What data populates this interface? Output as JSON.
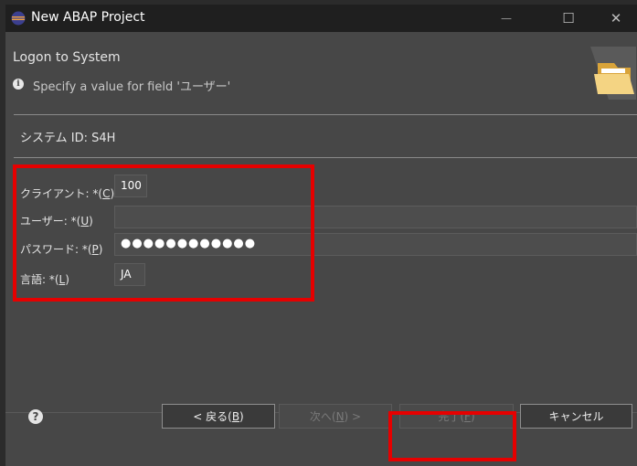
{
  "window": {
    "title": "New ABAP Project",
    "controls": {
      "minimize": "—",
      "maximize": "☐",
      "close": "✕"
    }
  },
  "header": {
    "title": "Logon to System",
    "message": "Specify a value for field 'ユーザー'",
    "info_icon": "i"
  },
  "system": {
    "label": "システム ID: S4H"
  },
  "form": {
    "client": {
      "label_prefix": "クライアント: *(",
      "mnemonic": "C",
      "label_suffix": ")",
      "value": "100"
    },
    "user": {
      "label_prefix": "ユーザー: *(",
      "mnemonic": "U",
      "label_suffix": ")",
      "value": ""
    },
    "password": {
      "label_prefix": "パスワード: *(",
      "mnemonic": "P",
      "label_suffix": ")",
      "value": "●●●●●●●●●●●●"
    },
    "language": {
      "label_prefix": "言語: *(",
      "mnemonic": "L",
      "label_suffix": ")",
      "value": "JA"
    }
  },
  "footer": {
    "help_icon": "?",
    "back": {
      "prefix": "< 戻る(",
      "mnemonic": "B",
      "suffix": ")"
    },
    "next": {
      "prefix": "次へ(",
      "mnemonic": "N",
      "suffix": ") >"
    },
    "finish": {
      "prefix": "完了(",
      "mnemonic": "F",
      "suffix": ")"
    },
    "cancel": "キャンセル"
  },
  "colors": {
    "highlight": "#e60000",
    "background": "#474747",
    "titlebar": "#1f1f1f"
  }
}
